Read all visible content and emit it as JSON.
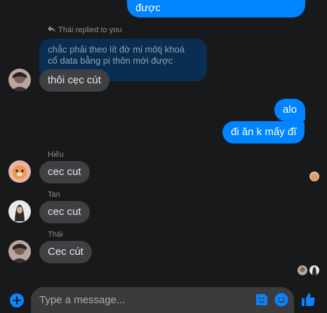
{
  "messages": {
    "top_partial": "được",
    "reply_header": "Thái replied to you",
    "quoted_line1": "chắc phải theo lít đờ mi môtj khoá",
    "quoted_line2": "cổ data bằng pi thôn mới được",
    "reply_text": "thôi cẹc cút",
    "out_alo": "alo",
    "out_di_an": "đi ăn k mấy đĩ",
    "hieu_name": "Hiếu",
    "hieu_text": "cec cut",
    "tan_name": "Tan",
    "tan_text": "cec cut",
    "thai_name": "Thái",
    "thai_text": "Cec cút"
  },
  "composer": {
    "placeholder": "Type a message..."
  },
  "colors": {
    "background": "#18191a",
    "outgoing_bubble": "#0084ff",
    "incoming_bubble": "#3e4042",
    "accent": "#0a84ff"
  },
  "icons": [
    "reply-icon",
    "add-circle-icon",
    "sticker-icon",
    "emoji-icon",
    "thumbs-up-icon"
  ]
}
